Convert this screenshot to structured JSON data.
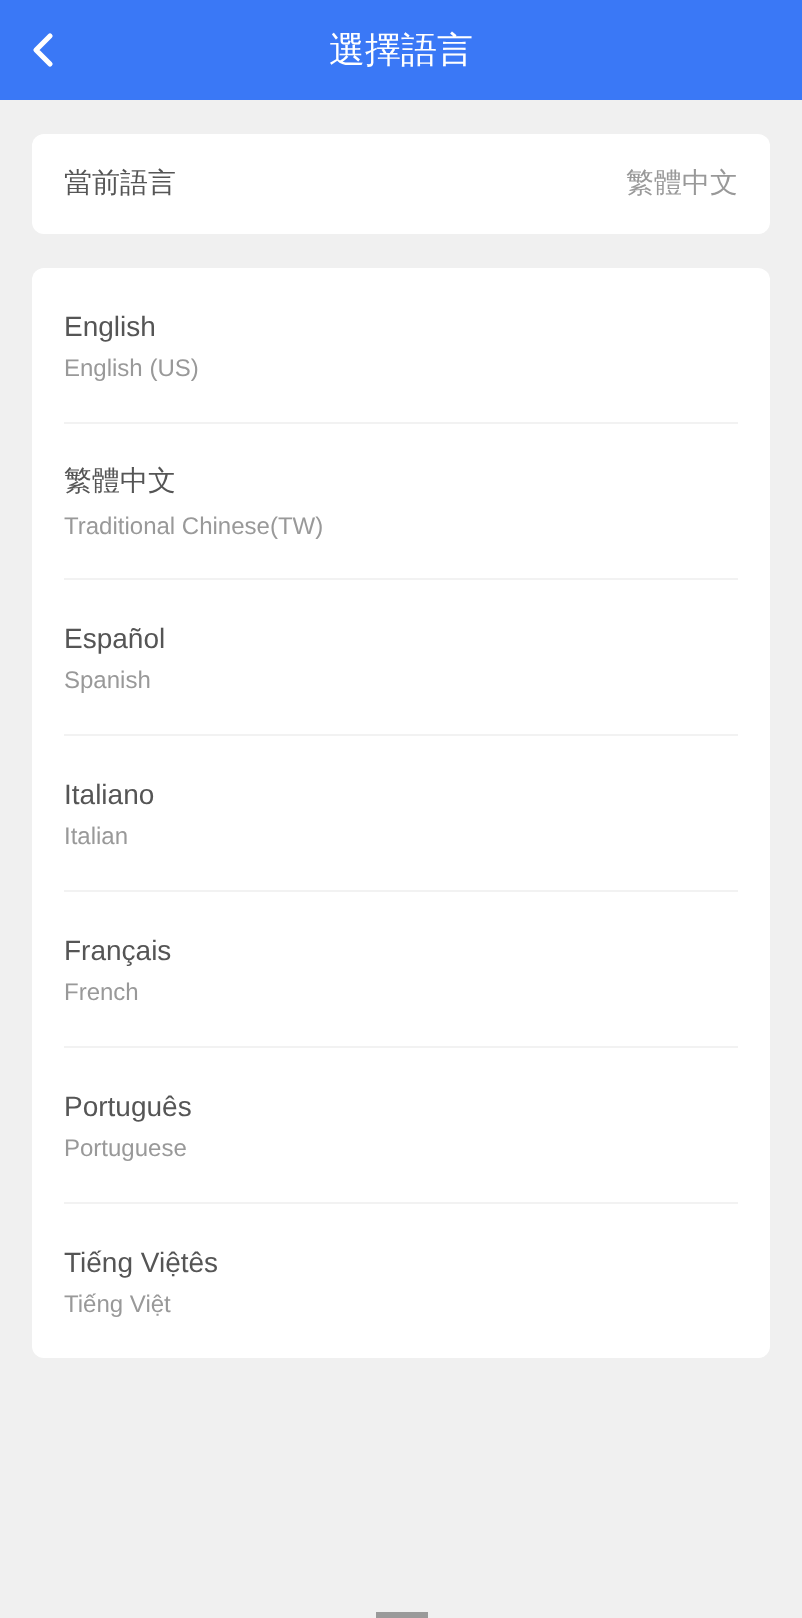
{
  "header": {
    "title": "選擇語言"
  },
  "current_language": {
    "label": "當前語言",
    "value": "繁體中文"
  },
  "languages": [
    {
      "name": "English",
      "subtitle": "English (US)"
    },
    {
      "name": "繁體中文",
      "subtitle": "Traditional Chinese(TW)"
    },
    {
      "name": "Español",
      "subtitle": "Spanish"
    },
    {
      "name": "Italiano",
      "subtitle": "Italian"
    },
    {
      "name": "Français",
      "subtitle": "French"
    },
    {
      "name": "Português",
      "subtitle": "Portuguese"
    },
    {
      "name": "Tiếng Việtês",
      "subtitle": "Tiếng Việt"
    }
  ]
}
